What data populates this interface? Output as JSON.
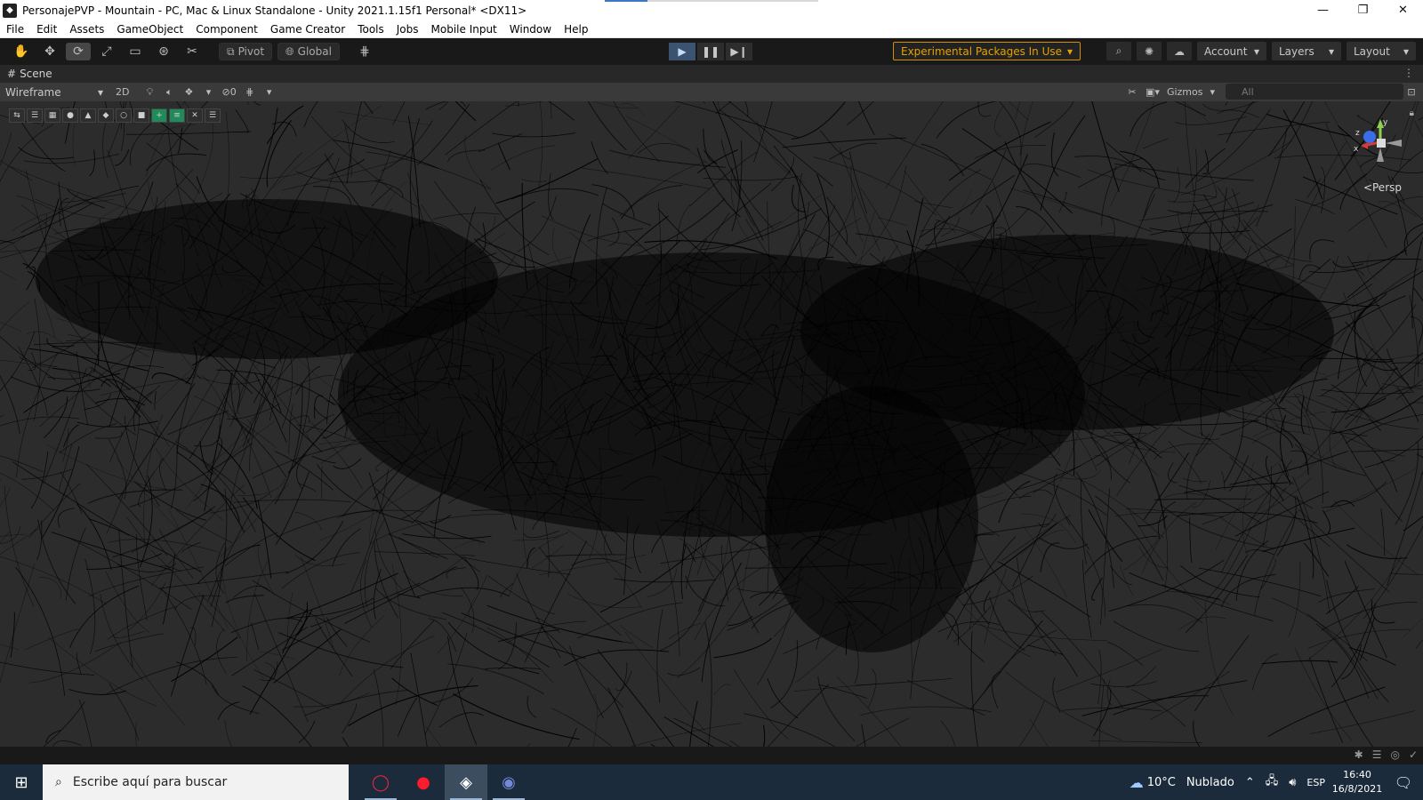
{
  "window": {
    "title": "PersonajePVP - Mountain - PC, Mac & Linux Standalone - Unity 2021.1.15f1 Personal* <DX11>",
    "minimize": "—",
    "maximize": "❐",
    "close": "✕"
  },
  "menu": [
    "File",
    "Edit",
    "Assets",
    "GameObject",
    "Component",
    "Game Creator",
    "Tools",
    "Jobs",
    "Mobile Input",
    "Window",
    "Help"
  ],
  "toolbar": {
    "pivot_label": "Pivot",
    "global_label": "Global",
    "experimental_label": "Experimental Packages In Use",
    "account_label": "Account",
    "layers_label": "Layers",
    "layout_label": "Layout"
  },
  "scene_tab": {
    "label": "Scene"
  },
  "scene_toolbar": {
    "shading_mode": "Wireframe",
    "two_d_label": "2D",
    "hidden_count": "0",
    "gizmos_label": "Gizmos",
    "search_placeholder": "All"
  },
  "scene_view": {
    "projection_label": "Persp",
    "axis_labels": {
      "x": "x",
      "y": "y",
      "z": "z"
    }
  },
  "taskbar": {
    "search_placeholder": "Escribe aquí para buscar",
    "weather_temp": "10°C",
    "weather_text": "Nublado",
    "language": "ESP",
    "time": "16:40",
    "date": "16/8/2021"
  },
  "colors": {
    "unity_dark": "#191919",
    "experimental_orange": "#e5a100",
    "taskbar_bg": "#1c2b3b",
    "scene_bg": "#2c2c2c"
  }
}
